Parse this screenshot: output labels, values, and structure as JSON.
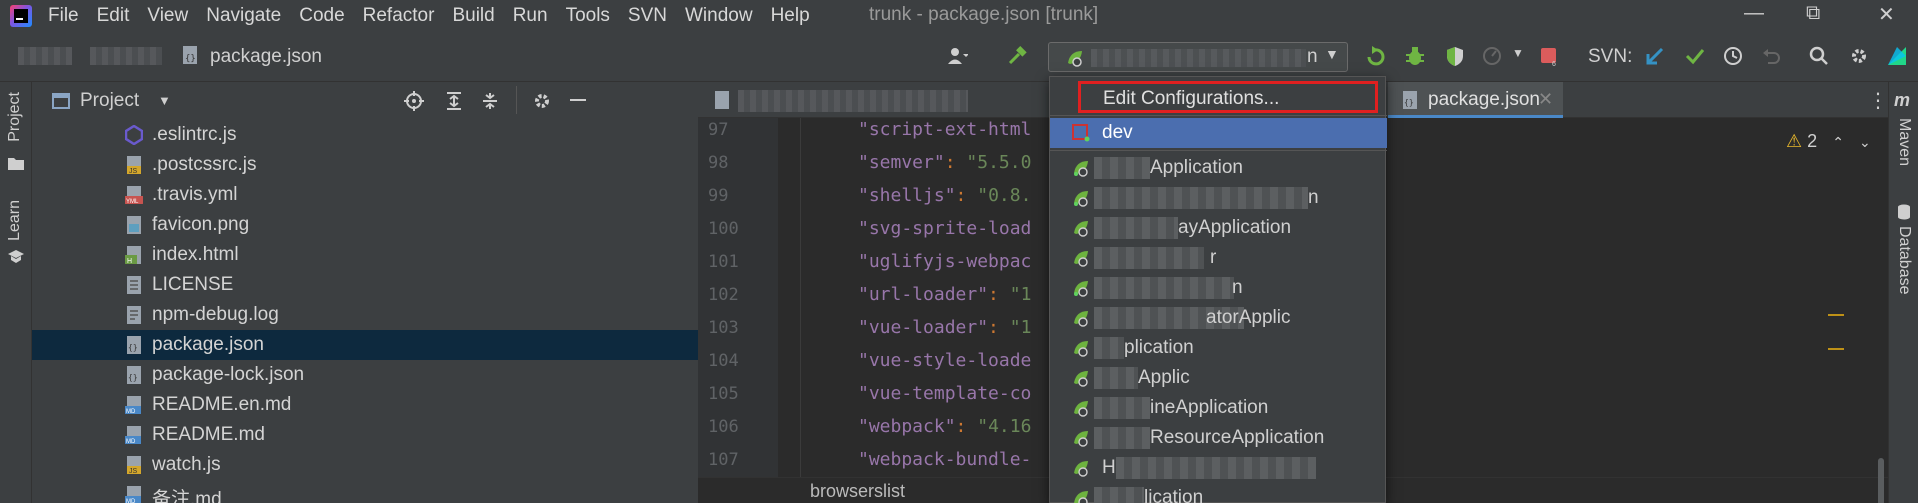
{
  "menubar": {
    "items": [
      "File",
      "Edit",
      "View",
      "Navigate",
      "Code",
      "Refactor",
      "Build",
      "Run",
      "Tools",
      "SVN",
      "Window",
      "Help"
    ],
    "window_title": "trunk - package.json [trunk]"
  },
  "toolbar": {
    "breadcrumb_file": "package.json",
    "run_config_suffix": "n",
    "svn_label": "SVN:"
  },
  "left_strip": {
    "project_label": "Project",
    "learn_label": "Learn"
  },
  "project_panel": {
    "title": "Project",
    "files": [
      {
        "name": ".eslintrc.js",
        "icon": "eslint-icon",
        "color": "#6a5acd"
      },
      {
        "name": ".postcssrc.js",
        "icon": "js-file-icon",
        "color": "#d4a72c"
      },
      {
        "name": ".travis.yml",
        "icon": "yml-file-icon",
        "color": "#c75450"
      },
      {
        "name": "favicon.png",
        "icon": "image-file-icon",
        "color": "#5e9fbf"
      },
      {
        "name": "index.html",
        "icon": "html-file-icon",
        "color": "#6a9a44"
      },
      {
        "name": "LICENSE",
        "icon": "text-file-icon",
        "color": "#9aa3ad"
      },
      {
        "name": "npm-debug.log",
        "icon": "log-file-icon",
        "color": "#9aa3ad"
      },
      {
        "name": "package.json",
        "icon": "json-file-icon",
        "color": "#9aa3ad",
        "selected": true
      },
      {
        "name": "package-lock.json",
        "icon": "json-file-icon",
        "color": "#9aa3ad"
      },
      {
        "name": "README.en.md",
        "icon": "md-file-icon",
        "color": "#4a88c7"
      },
      {
        "name": "README.md",
        "icon": "md-file-icon",
        "color": "#4a88c7"
      },
      {
        "name": "watch.js",
        "icon": "js-file-icon",
        "color": "#d4a72c"
      },
      {
        "name": "备注.md",
        "icon": "md-file-icon",
        "color": "#4a88c7"
      }
    ]
  },
  "editor": {
    "active_tab": "package.json",
    "breadcrumb": "browserslist",
    "warning_count": "2",
    "lines": [
      {
        "no": "97",
        "text": "\"script-ext-html"
      },
      {
        "no": "98",
        "key": "\"semver\"",
        "val": "\"5.5.0"
      },
      {
        "no": "99",
        "key": "\"shelljs\"",
        "val": "\"0.8."
      },
      {
        "no": "100",
        "text": "\"svg-sprite-load"
      },
      {
        "no": "101",
        "text": "\"uglifyjs-webpac"
      },
      {
        "no": "102",
        "key": "\"url-loader\"",
        "val": "\"1"
      },
      {
        "no": "103",
        "key": "\"vue-loader\"",
        "val": "\"1"
      },
      {
        "no": "104",
        "text": "\"vue-style-loade"
      },
      {
        "no": "105",
        "text": "\"vue-template-co"
      },
      {
        "no": "106",
        "key": "\"webpack\"",
        "val": "\"4.16"
      },
      {
        "no": "107",
        "text": "\"webpack-bundle-"
      }
    ]
  },
  "right_strip": {
    "maven_label": "Maven",
    "database_label": "Database"
  },
  "run_dropdown": {
    "edit_label": "Edit Configurations...",
    "selected": "dev",
    "items": [
      "Application",
      "n",
      "ayApplication",
      "r",
      "n",
      "atorApplic",
      "plication",
      "Applic",
      "ineApplication",
      "ResourceApplication",
      "H",
      "lication"
    ]
  },
  "colors": {
    "highlight": "#4b6eaf",
    "annotation_box": "#e02020",
    "selection": "#0d293e"
  }
}
